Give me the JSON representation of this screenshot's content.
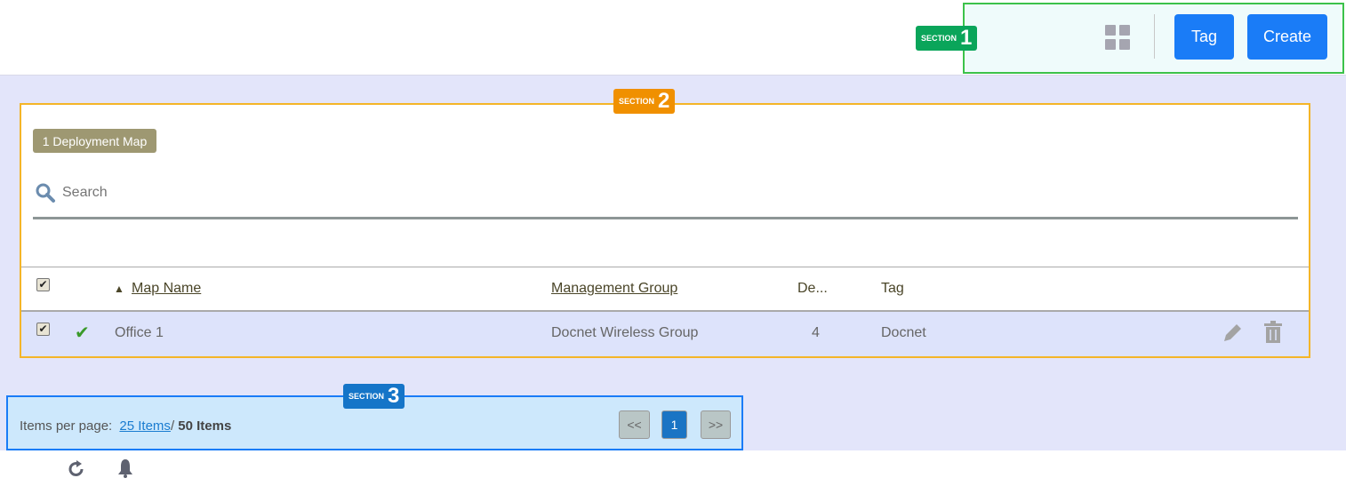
{
  "header": {
    "tag_label": "Tag",
    "create_label": "Create",
    "grid_icon": "grid-view-icon"
  },
  "annotations": [
    {
      "word": "SECTION",
      "number": "1",
      "color": "#0aa55a"
    },
    {
      "word": "SECTION",
      "number": "2",
      "color": "#f09000"
    },
    {
      "word": "SECTION",
      "number": "3",
      "color": "#1575c8"
    }
  ],
  "main": {
    "count_chip": "1 Deployment Map",
    "search_placeholder": "Search",
    "table": {
      "columns": [
        "Map Name",
        "Management Group",
        "De...",
        "Tag"
      ],
      "rows": [
        {
          "checked": true,
          "status": "ok",
          "name": "Office 1",
          "group": "Docnet Wireless Group",
          "devices": "4",
          "tag": "Docnet"
        }
      ]
    }
  },
  "pagination": {
    "label": "Items per page:",
    "per_page": "25 Items",
    "separator": "/",
    "total": "50 Items",
    "prev": "<<",
    "page": "1",
    "next": ">>"
  },
  "footer_icons": [
    "refresh-icon",
    "bell-icon"
  ]
}
